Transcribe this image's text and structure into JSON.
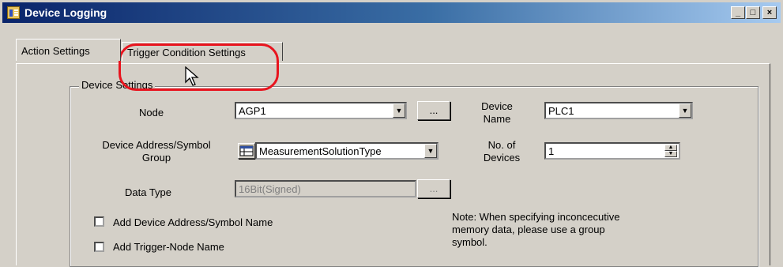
{
  "window": {
    "title": "Device Logging",
    "controls": {
      "minimize": "_",
      "maximize": "□",
      "close": "×"
    }
  },
  "tabs": [
    {
      "label": "Action Settings",
      "active": true
    },
    {
      "label": "Trigger Condition Settings",
      "active": false
    }
  ],
  "device_settings": {
    "legend": "Device Settings",
    "node_label": "Node",
    "node_value": "AGP1",
    "device_name_label_1": "Device",
    "device_name_label_2": "Name",
    "device_name_value": "PLC1",
    "address_label_1": "Device Address/Symbol",
    "address_label_2": "Group",
    "address_value": "MeasurementSolutionType",
    "num_devices_label_1": "No. of",
    "num_devices_label_2": "Devices",
    "num_devices_value": "1",
    "data_type_label": "Data Type",
    "data_type_value": "16Bit(Signed)",
    "browse_label": "...",
    "add_address_label": "Add Device Address/Symbol Name",
    "add_trigger_label": "Add Trigger-Node Name",
    "note_line_1": "Note: When specifying inconcecutive",
    "note_line_2": "memory data, please use a group",
    "note_line_3": "symbol."
  },
  "icons": {
    "app": "device-logging-icon",
    "symbol_group": "symbol-group-icon",
    "cursor": "mouse-pointer-icon"
  },
  "colors": {
    "highlight": "#e8141e",
    "titlebar_start": "#0a246a",
    "titlebar_end": "#a6caf0"
  }
}
